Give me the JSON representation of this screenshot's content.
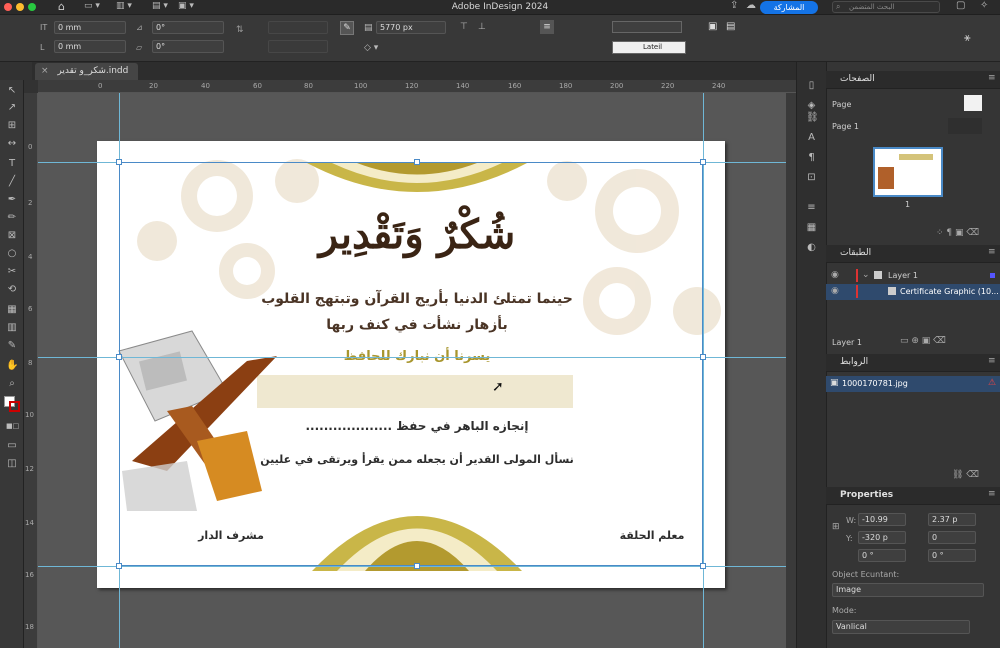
{
  "app": {
    "title": "Adobe InDesign 2024",
    "share_button": "المشاركة",
    "search_placeholder": "البحث المتضمن"
  },
  "control": {
    "x_value": "0 mm",
    "y_value": "0 mm",
    "angle1": "0°",
    "angle2": "0°",
    "width_px": "5770 px",
    "stroke_style": "Lateil"
  },
  "document": {
    "tab_name": "شكر_و تقدير.indd"
  },
  "ruler": {
    "ticks": [
      "0",
      "20",
      "40",
      "60",
      "80",
      "100",
      "120",
      "140",
      "160",
      "180",
      "200",
      "220",
      "240"
    ],
    "vticks": [
      "0",
      "2",
      "4",
      "6",
      "8",
      "10",
      "12",
      "14",
      "16",
      "18"
    ]
  },
  "certificate": {
    "title": "شُكْرٌ وَتَقْدِير",
    "line1": "حينما تمتلئ الدنيا بأريج القرآن وتبتهج القلوب",
    "line2": "بأزهار نشأت في كنف ربها",
    "line3": "يسرنا أن نبارك للحافظ",
    "line4": "إنجازه الباهر في حفظ ...................",
    "line5": "نسأل المولى القدير أن يجعله ممن يقرأ ويرتقى في عليين",
    "left_sign": "مشرف الدار",
    "right_sign": "معلم الحلقة"
  },
  "pages_panel": {
    "title": "الصفحات",
    "none_label": "Page",
    "page_label": "Page 1",
    "page_number": "1"
  },
  "layers_panel": {
    "title": "الطبقات",
    "layer1": "Layer 1",
    "graphic": "Certificate Graphic (10...",
    "footer": "Layer 1"
  },
  "links_panel": {
    "title": "الروابط",
    "file": "1000170781.jpg"
  },
  "properties": {
    "title": "Properties",
    "w_label": "W:",
    "w_value": "-10.99",
    "h_value": "2.37 p",
    "y_label": "Y:",
    "y_value": "-320 p",
    "r_value": "0",
    "a1": "0 °",
    "a2": "0 °",
    "section": "Object Ecuntant:",
    "type": "Image",
    "mode_label": "Mode:",
    "mode_value": "Vanlical"
  }
}
